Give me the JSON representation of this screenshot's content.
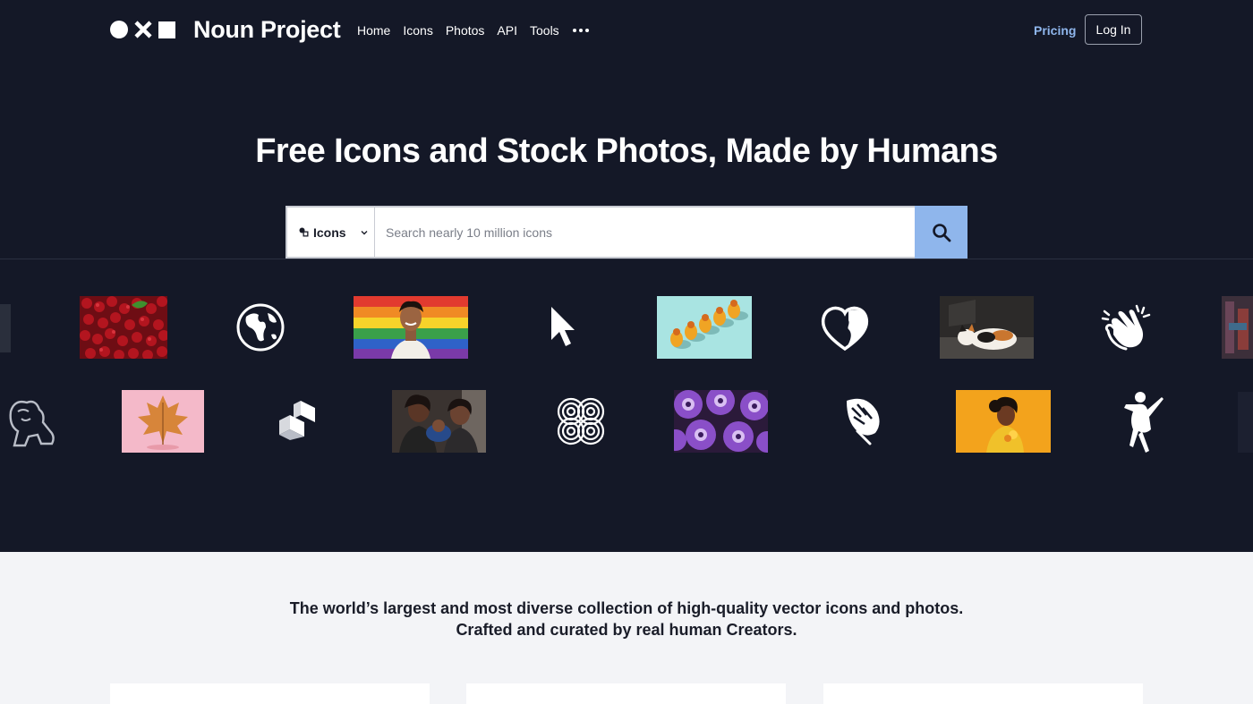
{
  "brand": {
    "name": "Noun Project"
  },
  "nav": {
    "links": [
      "Home",
      "Icons",
      "Photos",
      "API",
      "Tools"
    ],
    "more": "more-icon",
    "pricing": "Pricing",
    "login": "Log In"
  },
  "hero": {
    "title": "Free Icons and Stock Photos, Made by Humans"
  },
  "search": {
    "type_label": "Icons",
    "placeholder": "Search nearly 10 million icons",
    "value": ""
  },
  "tagline": {
    "line1": "The world’s largest and most diverse collection of high-quality vector icons and photos.",
    "line2": "Crafted and curated by real human Creators."
  },
  "colors": {
    "background": "#141827",
    "accent": "#8fb6ec",
    "lower_background": "#f3f4f7"
  },
  "gallery": {
    "row1": [
      "cherries-photo",
      "globe-icon",
      "rainbow-flag-portrait-photo",
      "cursor-icon",
      "pears-photo",
      "heart-face-icon",
      "cat-photo",
      "clapping-hands-icon"
    ],
    "row2": [
      "lion-icon",
      "autumn-leaf-photo",
      "blocks-icon",
      "family-photo",
      "spiral-pattern-icon",
      "petunias-photo",
      "monstera-leaf-icon",
      "woman-yellow-photo",
      "dancer-icon"
    ]
  }
}
